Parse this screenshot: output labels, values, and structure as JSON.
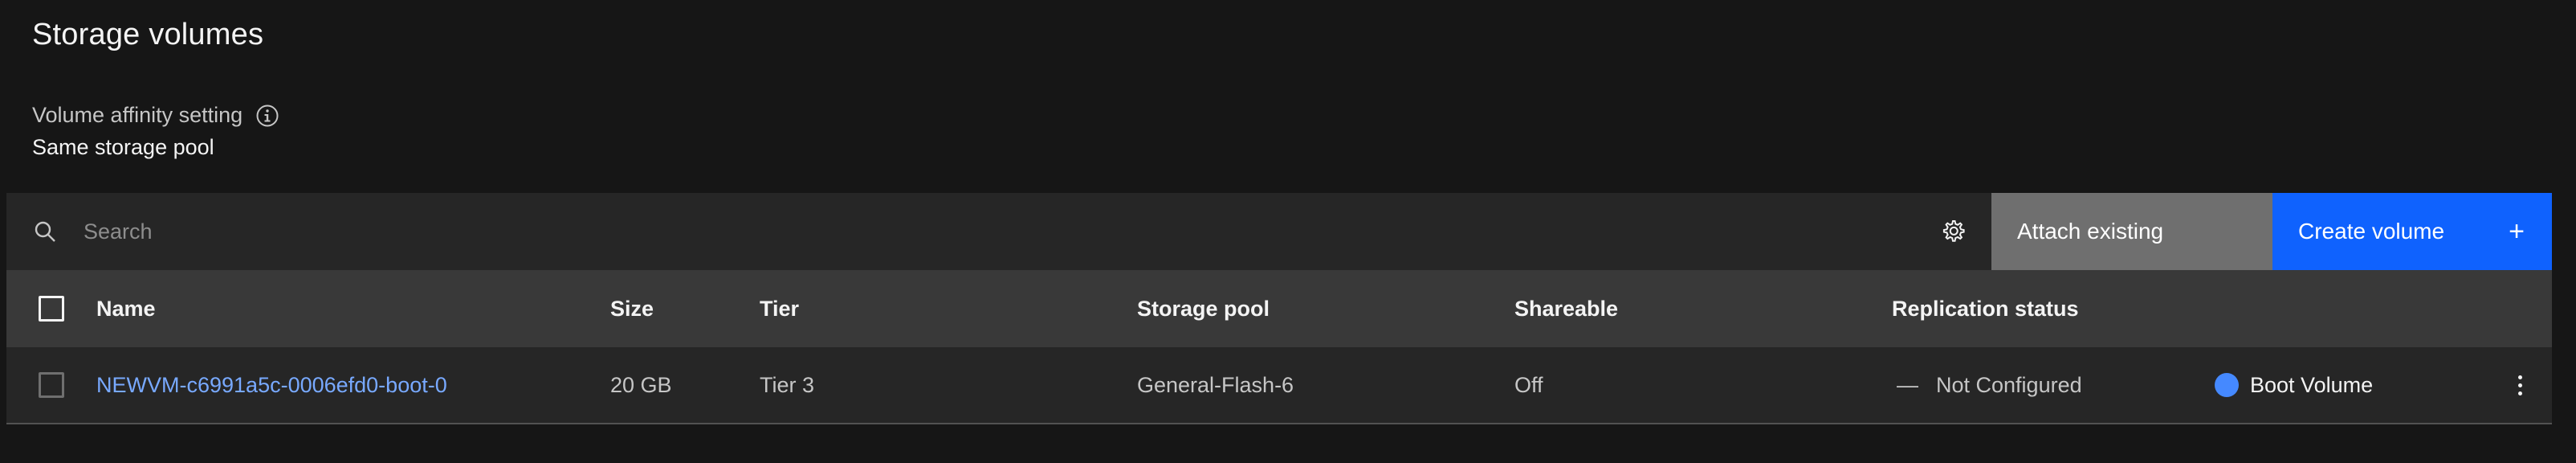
{
  "page": {
    "title": "Storage volumes",
    "affinity_label": "Volume affinity setting",
    "affinity_value": "Same storage pool"
  },
  "toolbar": {
    "search_placeholder": "Search",
    "attach_label": "Attach existing",
    "create_label": "Create volume",
    "create_icon": "+"
  },
  "table": {
    "headers": {
      "name": "Name",
      "size": "Size",
      "tier": "Tier",
      "pool": "Storage pool",
      "shareable": "Shareable",
      "replication": "Replication status"
    },
    "rows": [
      {
        "name": "NEWVM-c6991a5c-0006efd0-boot-0",
        "size": "20 GB",
        "tier": "Tier 3",
        "pool": "General-Flash-6",
        "shareable": "Off",
        "replication_dash": "—",
        "replication": "Not Configured",
        "boot": "Boot Volume"
      }
    ]
  },
  "icons": {
    "info": "info-icon",
    "search": "search-icon",
    "settings": "gear-icon",
    "add": "plus-icon",
    "row_menu": "overflow-menu-icon",
    "boot_status": "boot-volume-dot-icon"
  },
  "colors": {
    "background": "#161616",
    "toolbar": "#262626",
    "header": "#393939",
    "attach_button": "#6f6f6f",
    "create_button": "#0f62fe",
    "link": "#78a9ff",
    "boot_dot": "#4589ff"
  }
}
